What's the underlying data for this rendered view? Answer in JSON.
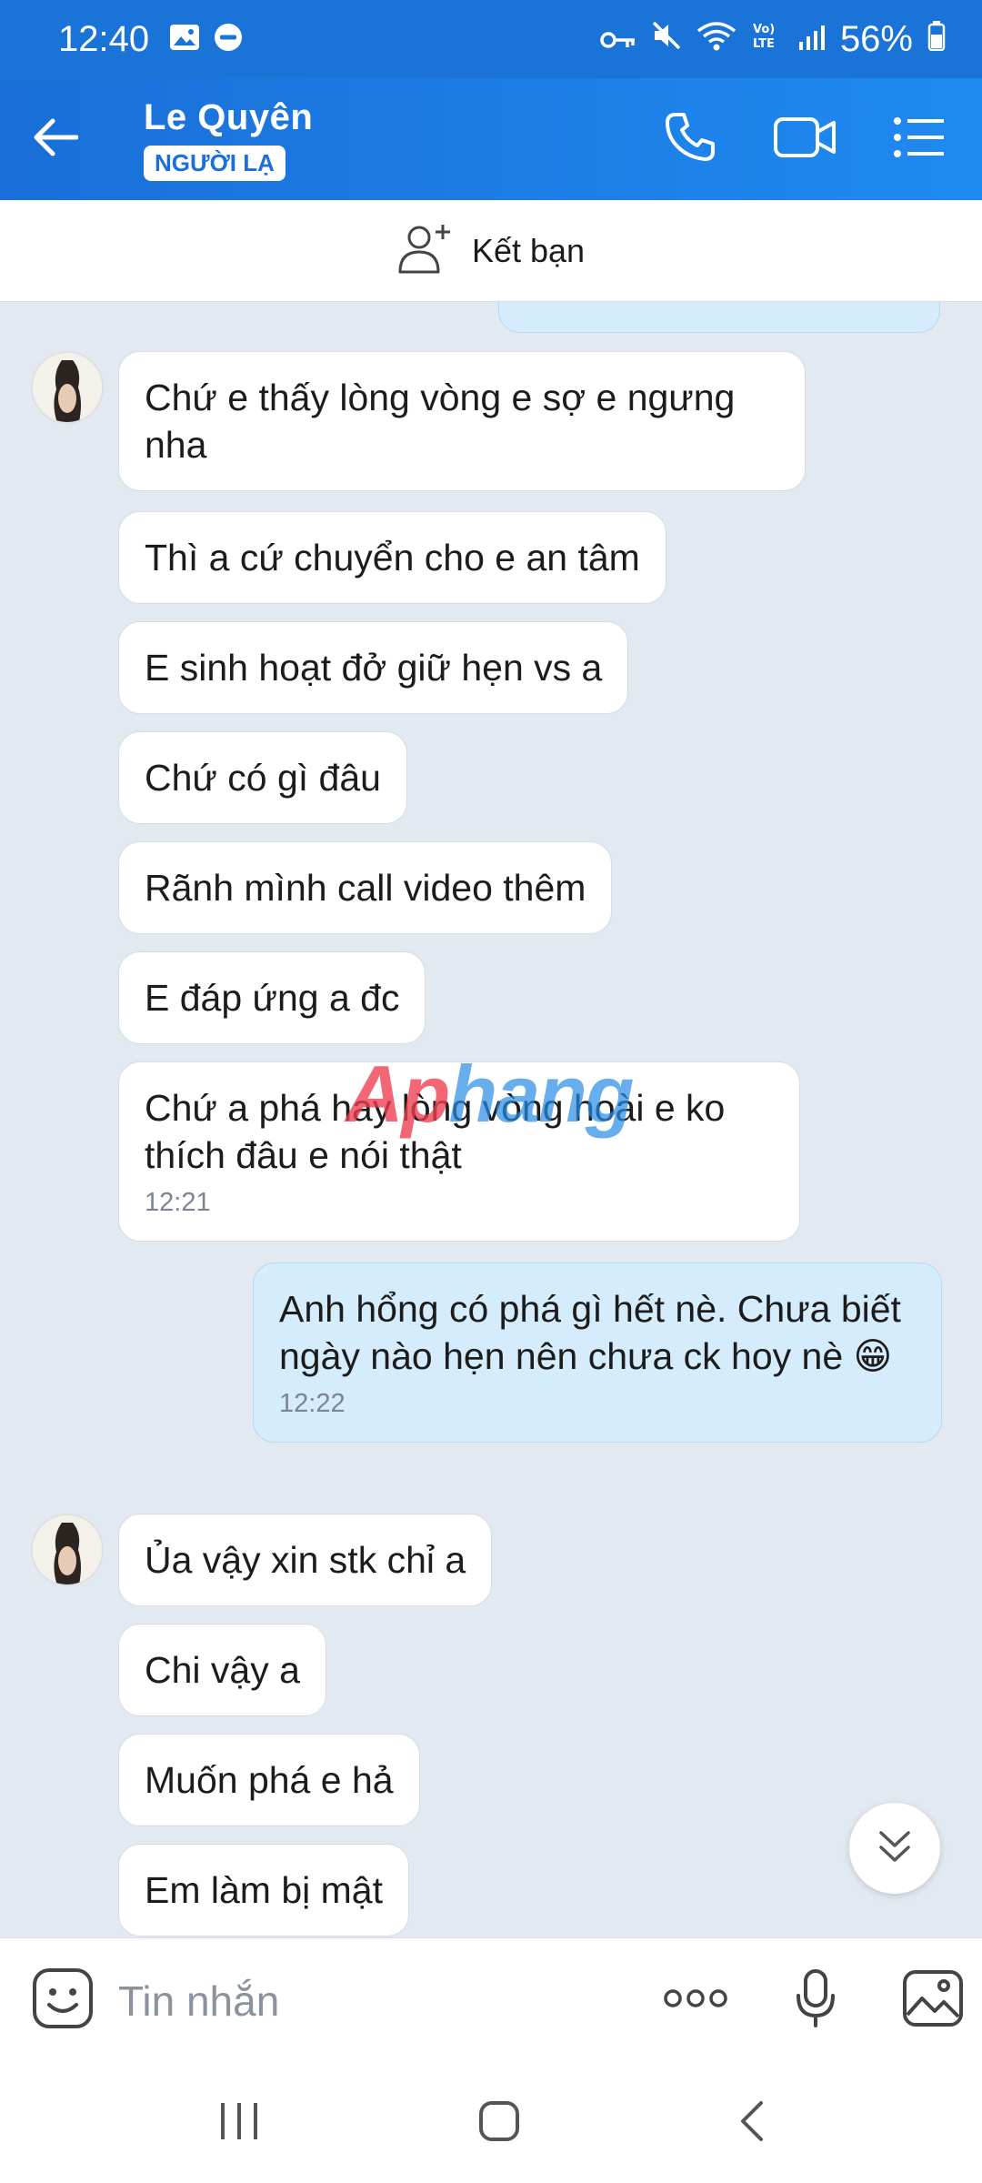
{
  "status_bar": {
    "time": "12:40",
    "battery": "56%"
  },
  "header": {
    "name": "Le Quyên",
    "badge": "NGƯỜI LẠ"
  },
  "add_friend": {
    "label": "Kết bạn"
  },
  "messages": [
    {
      "side": "received",
      "text": "Chứ e thấy lòng vòng e sợ e ngưng nha"
    },
    {
      "side": "received",
      "text": "Thì a cứ chuyển cho e an tâm"
    },
    {
      "side": "received",
      "text": "E sinh hoạt đở giữ hẹn vs a"
    },
    {
      "side": "received",
      "text": "Chứ có gì đâu"
    },
    {
      "side": "received",
      "text": "Rãnh mình call video thêm"
    },
    {
      "side": "received",
      "text": "E đáp ứng a đc"
    },
    {
      "side": "received",
      "text": "Chứ a phá hay lòng vòng hoài e ko thích đâu e nói thật",
      "time": "12:21"
    },
    {
      "side": "sent",
      "text": "Anh hổng có phá gì hết nè. Chưa biết ngày nào hẹn nên chưa ck hoy nè 😁",
      "time": "12:22"
    },
    {
      "side": "received",
      "text": "Ủa vậy xin stk chỉ a"
    },
    {
      "side": "received",
      "text": "Chi vậy a"
    },
    {
      "side": "received",
      "text": "Muốn phá e hả"
    },
    {
      "side": "received",
      "text": "Em làm bị mật"
    }
  ],
  "watermark": {
    "text_red": "Ap",
    "text_blue": "hang"
  },
  "input": {
    "placeholder": "Tin nhắn"
  }
}
